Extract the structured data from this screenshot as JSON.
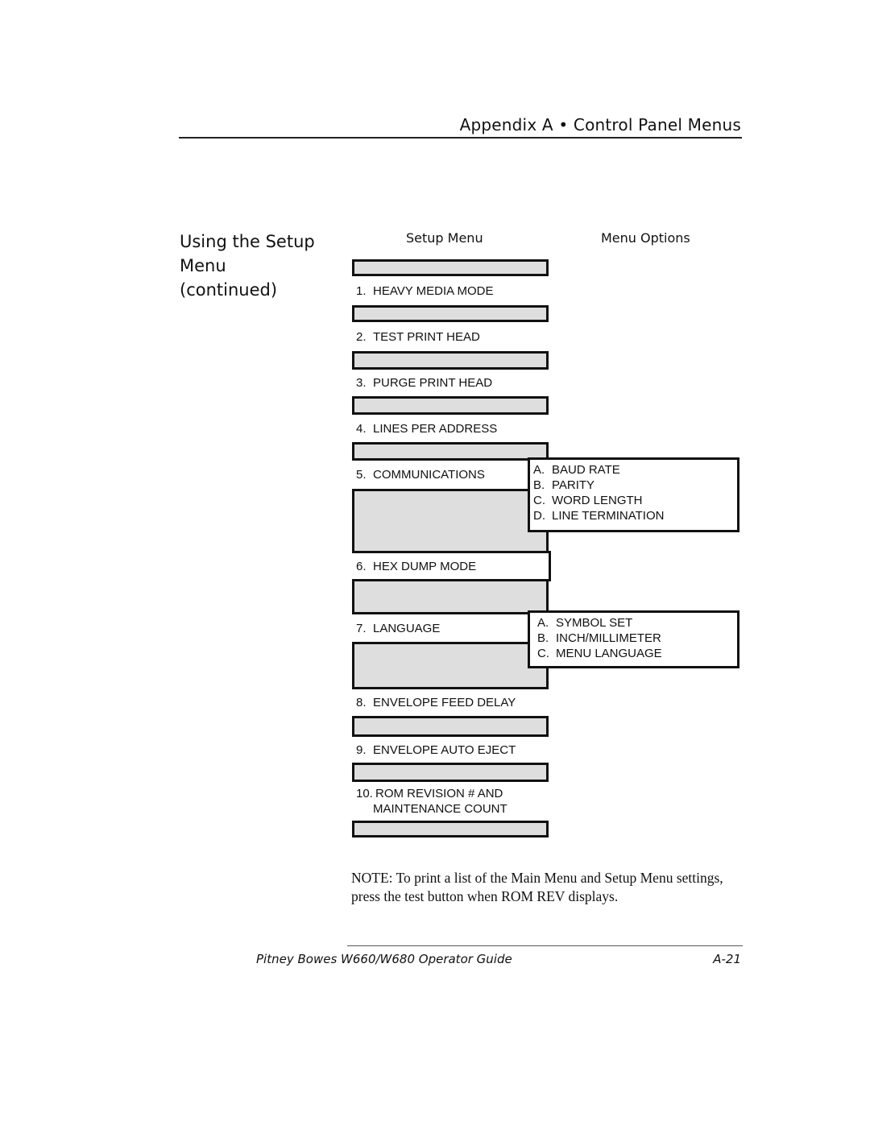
{
  "header": {
    "title": "Appendix A • Control Panel Menus"
  },
  "section": {
    "title_line1": "Using the Setup",
    "title_line2": "Menu",
    "title_line3": "(continued)"
  },
  "columns": {
    "setup_menu": "Setup Menu",
    "menu_options": "Menu Options"
  },
  "setup_menu_items": [
    {
      "num": "1.",
      "label": "HEAVY MEDIA MODE"
    },
    {
      "num": "2.",
      "label": "TEST PRINT HEAD"
    },
    {
      "num": "3.",
      "label": "PURGE PRINT HEAD"
    },
    {
      "num": "4.",
      "label": "LINES PER ADDRESS"
    },
    {
      "num": "5.",
      "label": "COMMUNICATIONS"
    },
    {
      "num": "6.",
      "label": "HEX DUMP MODE"
    },
    {
      "num": "7.",
      "label": "LANGUAGE"
    },
    {
      "num": "8.",
      "label": "ENVELOPE FEED DELAY"
    },
    {
      "num": "9.",
      "label": "ENVELOPE AUTO EJECT"
    },
    {
      "num": "10.",
      "label": "ROM REVISION # AND",
      "label2": "MAINTENANCE COUNT"
    }
  ],
  "communications_options": [
    {
      "letter": "A.",
      "label": "BAUD RATE"
    },
    {
      "letter": "B.",
      "label": "PARITY"
    },
    {
      "letter": "C.",
      "label": "WORD LENGTH"
    },
    {
      "letter": "D.",
      "label": "LINE TERMINATION"
    }
  ],
  "language_options": [
    {
      "letter": "A.",
      "label": "SYMBOL SET"
    },
    {
      "letter": "B.",
      "label": "INCH/MILLIMETER"
    },
    {
      "letter": "C.",
      "label": "MENU LANGUAGE"
    }
  ],
  "note": "NOTE: To print a list of the Main Menu and Setup Menu settings, press the test button when ROM REV displays.",
  "footer": {
    "guide_title": "Pitney Bowes W660/W680 Operator Guide",
    "page_number": "A-21"
  }
}
